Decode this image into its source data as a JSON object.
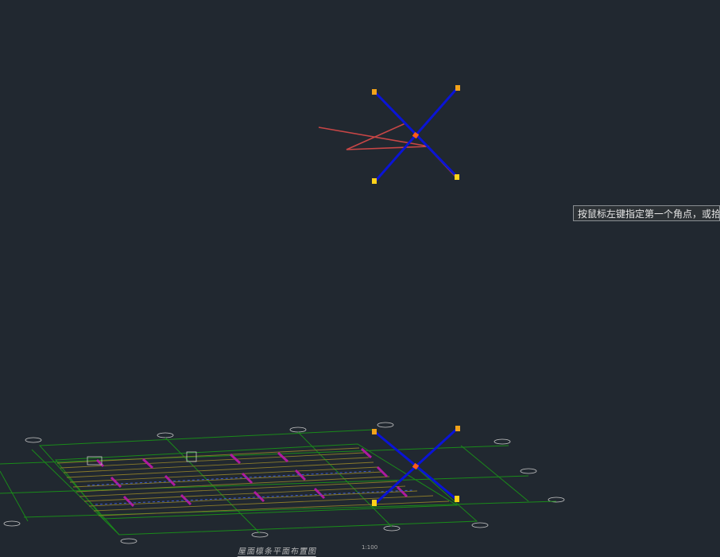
{
  "canvas": {
    "background": "#212830"
  },
  "tooltip": {
    "text": "按鼠标左键指定第一个角点，或拾"
  },
  "drawing": {
    "title": "屋面檩条平面布置图",
    "scale": "1:100"
  },
  "colors": {
    "brace": "#0a14d6",
    "path": "#c84646",
    "grip": "#f2a21a",
    "grip_hot": "#ffd21a",
    "grid": "#1a8a1a",
    "purlin": "#8a7a2a",
    "member": "#b01aa0",
    "axis": "#c8c8c8"
  },
  "icons": {
    "grip": "grip-square-icon",
    "midpoint": "midpoint-grip-icon"
  }
}
